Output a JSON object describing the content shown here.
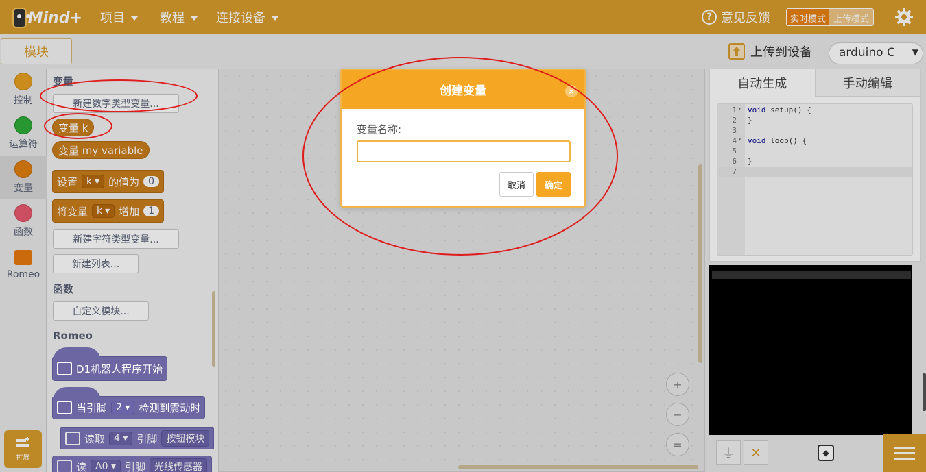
{
  "topbar": {
    "logo_text": "Mind+",
    "menu": [
      {
        "label": "项目"
      },
      {
        "label": "教程"
      },
      {
        "label": "连接设备"
      }
    ],
    "feedback_label": "意见反馈",
    "mode_realtime": "实时模式",
    "mode_upload": "上传模式"
  },
  "subbar": {
    "modules_tab": "模块",
    "upload_label": "上传到设备",
    "device": "arduino C"
  },
  "categories": [
    {
      "label": "控制",
      "color": "#e6a020",
      "icon": "circle"
    },
    {
      "label": "运算符",
      "color": "#2eac3a",
      "icon": "circle"
    },
    {
      "label": "变量",
      "color": "#e07f10",
      "icon": "circle",
      "active": true
    },
    {
      "label": "函数",
      "color": "#e85a6e",
      "icon": "circle"
    },
    {
      "label": "Romeo",
      "color": "#e8780f",
      "icon": "robot-box"
    }
  ],
  "extension_label": "扩展",
  "palette": {
    "variables_header": "变量",
    "new_number_var": "新建数字类型变量...",
    "var_k": "变量 k",
    "var_my_variable": "变量 my variable",
    "set_block": {
      "prefix": "设置",
      "var": "k",
      "middle": "的值为",
      "value": "0"
    },
    "change_block": {
      "prefix": "将变量",
      "var": "k",
      "middle": "增加",
      "value": "1"
    },
    "new_string_var": "新建字符类型变量...",
    "new_list": "新建列表...",
    "functions_header": "函数",
    "custom_block": "自定义模块...",
    "romeo_header": "Romeo",
    "romeo_blocks": {
      "start": "D1机器人程序开始",
      "vibration": {
        "prefix": "当引脚",
        "pin": "2",
        "suffix": "检测到震动时"
      },
      "button": {
        "prefix": "读取",
        "pin": "4",
        "mid": "引脚",
        "suffix": "按钮模块"
      },
      "light": {
        "prefix": "读",
        "pin": "A0",
        "mid": "引脚",
        "suffix": "光线传感器"
      }
    }
  },
  "workspace": {
    "zoom_in": "+",
    "zoom_out": "−",
    "zoom_reset": "="
  },
  "code": {
    "tab_auto": "自动生成",
    "tab_manual": "手动编辑",
    "lines": [
      {
        "n": "1",
        "fold": "▾",
        "text": "void setup() {"
      },
      {
        "n": "2",
        "fold": "",
        "text": "}"
      },
      {
        "n": "3",
        "fold": "",
        "text": ""
      },
      {
        "n": "4",
        "fold": "▾",
        "text": "void loop() {"
      },
      {
        "n": "5",
        "fold": "",
        "text": ""
      },
      {
        "n": "6",
        "fold": "",
        "text": "}"
      },
      {
        "n": "7",
        "fold": "",
        "text": ""
      }
    ]
  },
  "dialog": {
    "title": "创建变量",
    "close": "×",
    "label": "变量名称:",
    "input_value": "",
    "cancel": "取消",
    "ok": "确定"
  },
  "colors": {
    "brand": "#d89b2c",
    "dialog_header": "#f5a623",
    "variable_block": "#c97e1c",
    "romeo_block": "#7c76b9",
    "annotation": "#e01b1b"
  }
}
